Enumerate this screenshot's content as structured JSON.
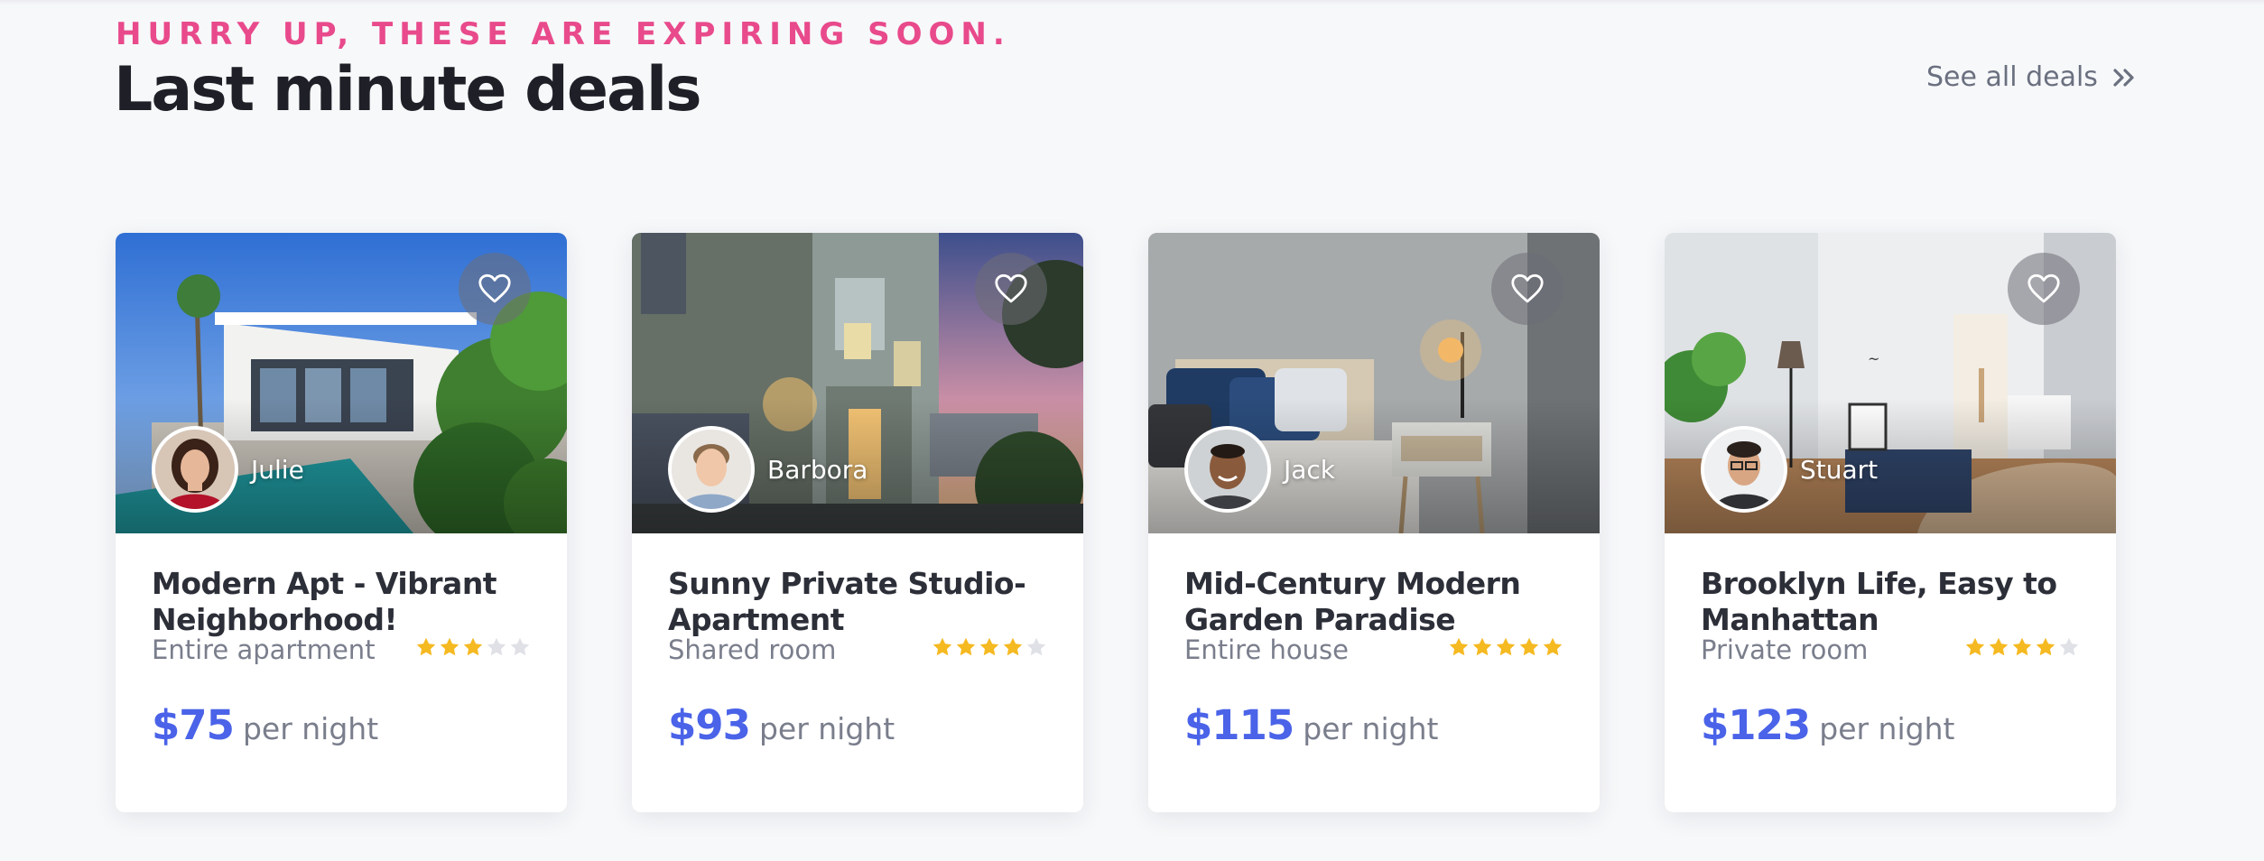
{
  "section": {
    "eyebrow": "HURRY UP, THESE ARE EXPIRING SOON.",
    "title": "Last minute deals",
    "see_all_label": "See all deals",
    "see_all_icon": "double-chevron-right-icon"
  },
  "colors": {
    "accent_pink": "#e84a8b",
    "price_blue": "#4a63e8",
    "star_filled": "#f5b921",
    "star_empty": "#dfe1e6"
  },
  "deals": [
    {
      "host": "Julie",
      "title": "Modern Apt - Vibrant Neighborhood!",
      "room_type": "Entire apartment",
      "rating": 3,
      "rating_max": 5,
      "price": "$75",
      "price_unit": "per night",
      "favorite_icon": "heart-outline-icon"
    },
    {
      "host": "Barbora",
      "title": "Sunny Private Studio-Apartment",
      "room_type": "Shared room",
      "rating": 4,
      "rating_max": 5,
      "price": "$93",
      "price_unit": "per night",
      "favorite_icon": "heart-outline-icon"
    },
    {
      "host": "Jack",
      "title": "Mid-Century Modern Garden Paradise",
      "room_type": "Entire house",
      "rating": 5,
      "rating_max": 5,
      "price": "$115",
      "price_unit": "per night",
      "favorite_icon": "heart-outline-icon"
    },
    {
      "host": "Stuart",
      "title": "Brooklyn Life, Easy to Manhattan",
      "room_type": "Private room",
      "rating": 4,
      "rating_max": 5,
      "price": "$123",
      "price_unit": "per night",
      "favorite_icon": "heart-outline-icon"
    }
  ]
}
